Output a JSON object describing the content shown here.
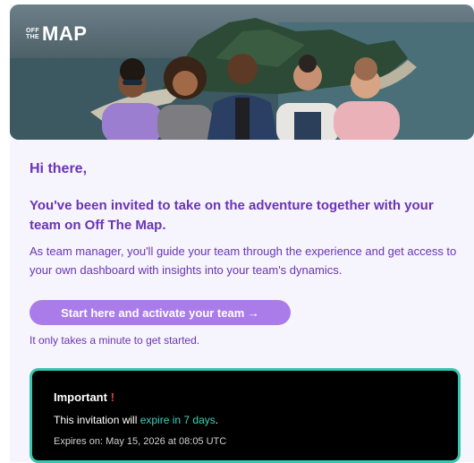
{
  "brand": {
    "logo_small_line1": "OFF",
    "logo_small_line2": "THE",
    "logo_big": "MAP"
  },
  "email": {
    "greeting": "Hi there,",
    "headline": "You've been invited to take on the adventure together with your team on Off The Map.",
    "body": "As team manager, you'll guide your team through the experience and get access to your own dashboard with insights into your team's dynamics.",
    "cta_label": "Start here and activate your team →",
    "note": "It only takes a minute to get started."
  },
  "notice": {
    "title": "Important",
    "title_mark": "!",
    "line_prefix": "This invitation will ",
    "line_highlight": "expire in 7 days",
    "line_suffix": ".",
    "expires": "Expires on: May 15, 2026 at 08:05 UTC"
  },
  "colors": {
    "accent_purple": "#6a34b6",
    "button_purple": "#a97ce9",
    "teal": "#38c6b0",
    "alert_red": "#e83b3b"
  }
}
